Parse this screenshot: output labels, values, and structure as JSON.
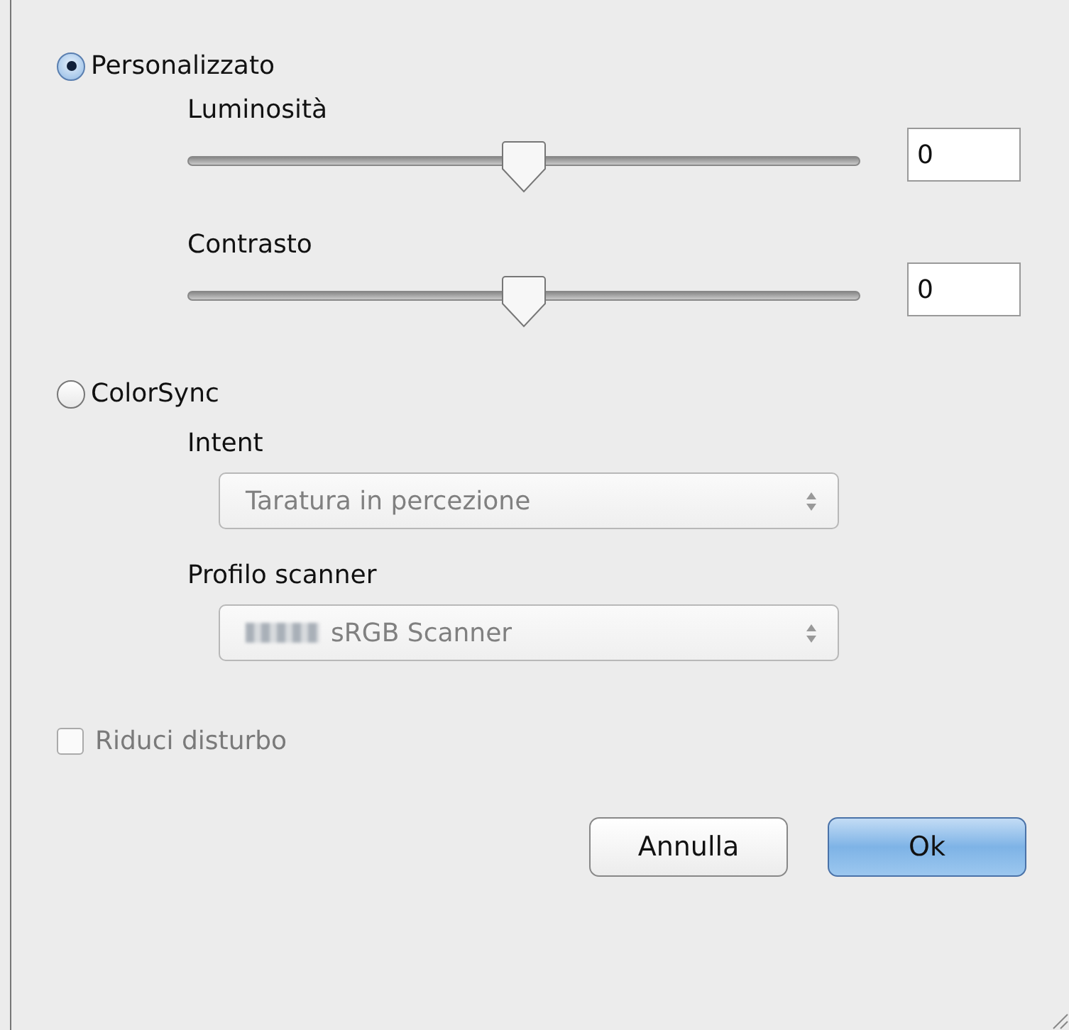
{
  "options": [
    {
      "kind": "sliders",
      "label": "Personalizzato",
      "selected": true,
      "sliders": [
        {
          "label": "Luminosità",
          "level": 0.5,
          "value": "0"
        },
        {
          "label": "Contrasto",
          "level": 0.5,
          "value": "0"
        }
      ]
    },
    {
      "kind": "selects",
      "label": "ColorSync",
      "selected": false,
      "selects": [
        {
          "label": "Intent",
          "value": "Taratura in percezione",
          "disabled": true,
          "redacted": false
        },
        {
          "label": "Profilo scanner",
          "value": "sRGB Scanner",
          "disabled": true,
          "redacted": true
        }
      ]
    }
  ],
  "checkbox": {
    "label": "Riduci disturbo",
    "checked": false,
    "disabled": true
  },
  "buttons": [
    {
      "label": "Annulla",
      "default": false
    },
    {
      "label": "Ok",
      "default": true
    }
  ]
}
